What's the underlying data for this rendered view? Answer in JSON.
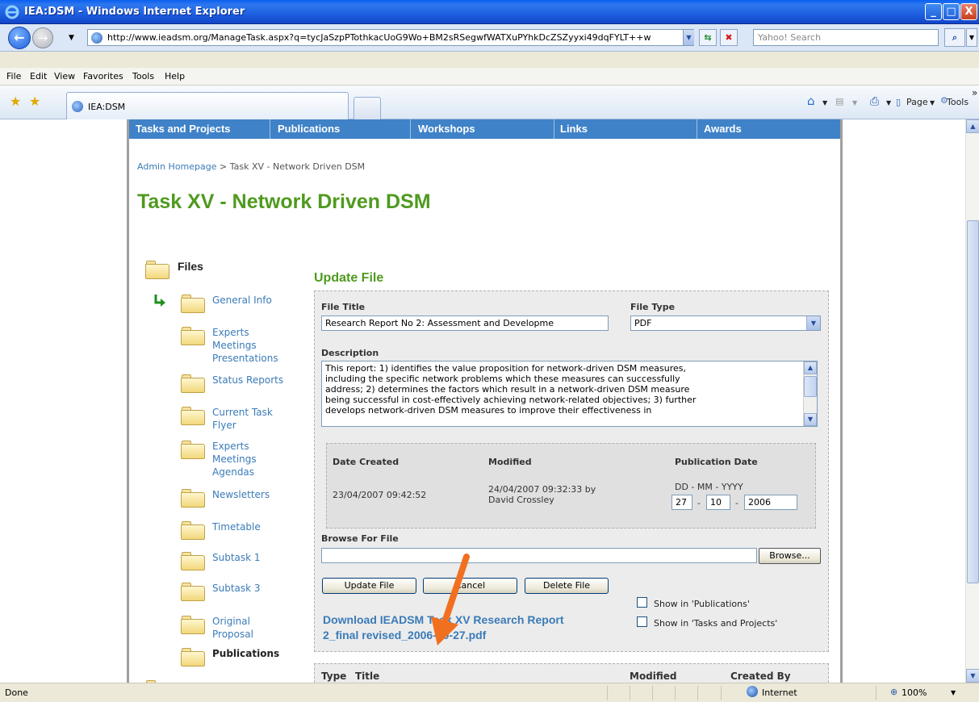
{
  "window": {
    "title": "IEA:DSM - Windows Internet Explorer",
    "minimize": "_",
    "maximize": "□",
    "close": "X"
  },
  "addressbar": {
    "url": "http://www.ieadsm.org/ManageTask.aspx?q=tycJaSzpPTothkacUoG9Wo+BM2sRSegwfWATXuPYhkDcZSZyyxi49dqFYLT++w",
    "search_placeholder": "Yahoo! Search"
  },
  "menubar": {
    "items": [
      "File",
      "Edit",
      "View",
      "Favorites",
      "Tools",
      "Help"
    ]
  },
  "tabbar": {
    "active_tab": "IEA:DSM",
    "page_label": "Page",
    "tools_label": "Tools",
    "overflow": "»"
  },
  "site_nav": {
    "items": [
      "Tasks and Projects",
      "Publications",
      "Workshops",
      "Links",
      "Awards"
    ]
  },
  "breadcrumb": {
    "home": "Admin Homepage",
    "sep": " > ",
    "current": "Task XV - Network Driven DSM"
  },
  "page_title": "Task XV - Network Driven DSM",
  "files_tree": {
    "root": "Files",
    "items": [
      {
        "label": "General Info",
        "lines": [
          "General Info"
        ]
      },
      {
        "label": "Experts Meetings Presentations",
        "lines": [
          "Experts",
          "Meetings",
          "Presentations"
        ]
      },
      {
        "label": "Status Reports",
        "lines": [
          "Status Reports"
        ]
      },
      {
        "label": "Current Task Flyer",
        "lines": [
          "Current Task",
          "Flyer"
        ]
      },
      {
        "label": "Experts Meetings Agendas",
        "lines": [
          "Experts",
          "Meetings",
          "Agendas"
        ]
      },
      {
        "label": "Newsletters",
        "lines": [
          "Newsletters"
        ]
      },
      {
        "label": "Timetable",
        "lines": [
          "Timetable"
        ]
      },
      {
        "label": "Subtask 1",
        "lines": [
          "Subtask 1"
        ]
      },
      {
        "label": "Subtask 3",
        "lines": [
          "Subtask 3"
        ]
      },
      {
        "label": "Original Proposal",
        "lines": [
          "Original",
          "Proposal"
        ]
      },
      {
        "label": "Publications",
        "lines": [
          "Publications"
        ]
      }
    ]
  },
  "update_file": {
    "heading": "Update File",
    "file_title_label": "File Title",
    "file_title_value": "Research Report No 2:  Assessment and Developme",
    "file_type_label": "File Type",
    "file_type_value": "PDF",
    "description_label": "Description",
    "description_lines": [
      "This report: 1) identifies the value proposition for network-driven DSM measures,",
      "including the specific network problems which these measures can successfully",
      "address; 2) determines the factors which result in a network-driven DSM measure",
      "being successful in cost-effectively achieving network-related objectives; 3) further",
      "develops network-driven DSM measures to improve their effectiveness in"
    ],
    "date_created_label": "Date Created",
    "date_created_value": "23/04/2007 09:42:52",
    "modified_label": "Modified",
    "modified_value_line1": "24/04/2007 09:32:33 by",
    "modified_value_line2": "David Crossley",
    "publication_date_label": "Publication Date",
    "date_format_hint": "DD - MM - YYYY",
    "pub_day": "27",
    "pub_month": "10",
    "pub_year": "2006",
    "date_sep": "-",
    "browse_label": "Browse For File",
    "browse_button": "Browse...",
    "update_button": "Update File",
    "cancel_button": "Cancel",
    "delete_button": "Delete File",
    "show_publications": "Show in 'Publications'",
    "show_tasks": "Show in 'Tasks and Projects'",
    "download_line1": "Download IEADSM Task XV Research Report",
    "download_line2": "2_final revised_2006-10-27.pdf"
  },
  "table": {
    "headers": [
      "Type",
      "Title",
      "Modified",
      "Created By"
    ]
  },
  "statusbar": {
    "status": "Done",
    "zone": "Internet",
    "zoom": "100%"
  },
  "colors": {
    "accent_green": "#4f9a1e",
    "link_blue": "#3a7bb8",
    "nav_blue": "#3f82c8",
    "annotation_orange": "#f07020"
  }
}
